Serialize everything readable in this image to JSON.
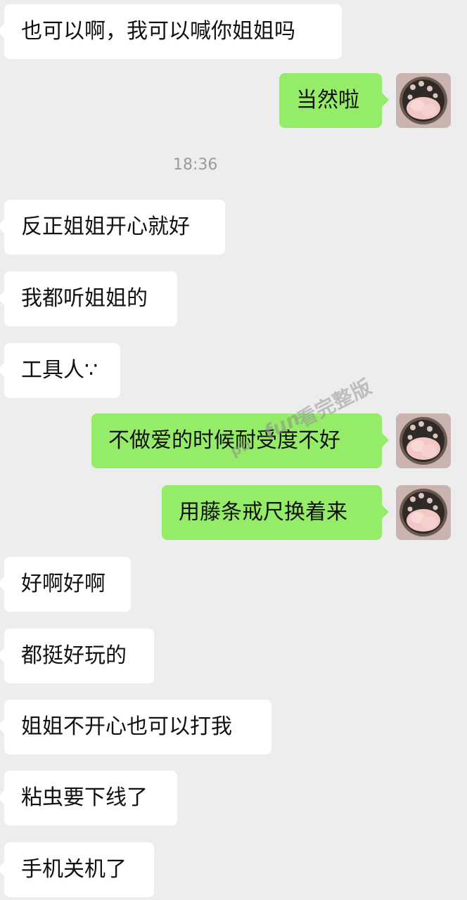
{
  "chat": {
    "timestamp": "18:36",
    "messages": [
      {
        "side": "left",
        "text": "也可以啊，我可以喊你姐姐吗"
      },
      {
        "side": "right",
        "text": "当然啦"
      },
      {
        "side": "left",
        "text": "反正姐姐开心就好"
      },
      {
        "side": "left",
        "text": "我都听姐姐的"
      },
      {
        "side": "left",
        "text": "工具人∵"
      },
      {
        "side": "right",
        "text": "不做爱的时候耐受度不好"
      },
      {
        "side": "right",
        "text": "用藤条戒尺换着来"
      },
      {
        "side": "left",
        "text": "好啊好啊"
      },
      {
        "side": "left",
        "text": "都挺好玩的"
      },
      {
        "side": "left",
        "text": "姐姐不开心也可以打我"
      },
      {
        "side": "left",
        "text": "粘虫要下线了"
      },
      {
        "side": "left",
        "text": "手机关机了"
      }
    ]
  },
  "watermark": {
    "part1": "pb",
    "part2": "fun",
    "part3": "看完整版"
  },
  "colors": {
    "background": "#ededed",
    "left_bubble": "#ffffff",
    "right_bubble": "#95ec69",
    "timestamp_text": "#9b9b9b"
  }
}
